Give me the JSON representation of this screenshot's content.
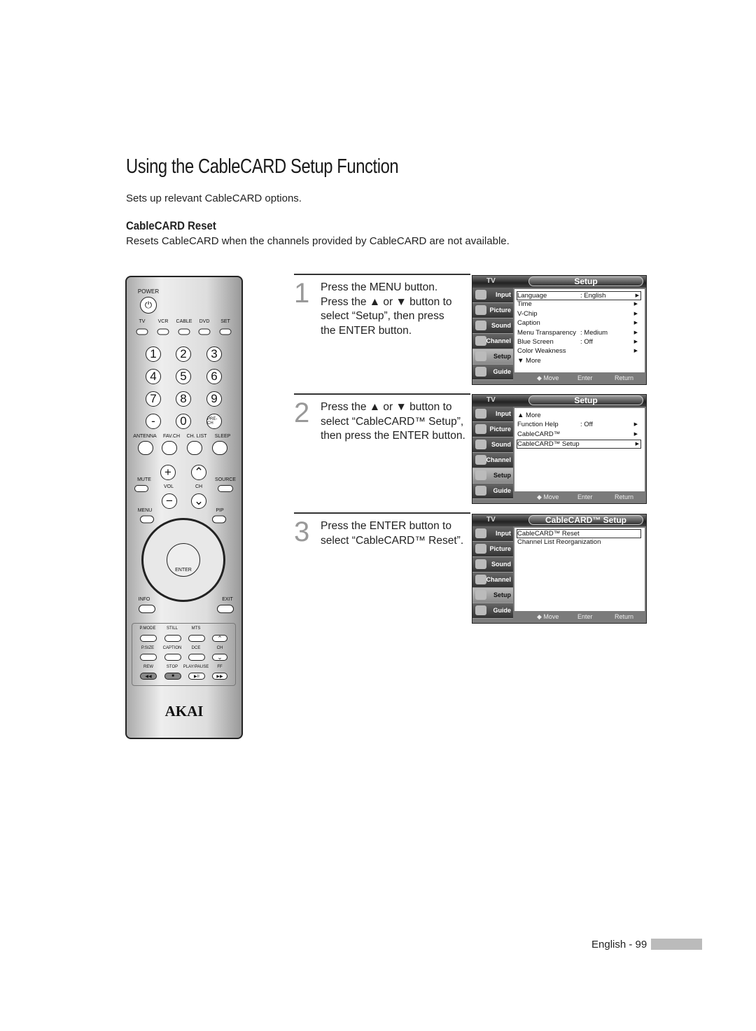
{
  "title": "Using the CableCARD Setup Function",
  "intro": "Sets up relevant CableCARD options.",
  "section": {
    "heading": "CableCARD Reset",
    "description": "Resets CableCARD when the channels provided by CableCARD are not available."
  },
  "steps": [
    {
      "number": "1",
      "text": "Press the MENU button.\nPress the ▲ or ▼ button to\nselect “Setup”, then press\nthe ENTER button."
    },
    {
      "number": "2",
      "text": "Press the ▲ or ▼ button to\nselect “CableCARD™ Setup”,\nthen press the ENTER button."
    },
    {
      "number": "3",
      "text": "Press the ENTER button to\nselect “CableCARD™ Reset”."
    }
  ],
  "osd_common": {
    "tv": "TV",
    "sidebar": [
      "Input",
      "Picture",
      "Sound",
      "Channel",
      "Setup",
      "Guide"
    ],
    "selected": "Setup",
    "move": "◆ Move",
    "enter": "Enter",
    "return": "Return"
  },
  "screens": [
    {
      "title": "Setup",
      "rows": [
        {
          "label": "Language",
          "value": ": English",
          "arrow": "▶",
          "highlight": true
        },
        {
          "label": "Time",
          "value": "",
          "arrow": "▶"
        },
        {
          "label": "V-Chip",
          "value": "",
          "arrow": "▶"
        },
        {
          "label": "Caption",
          "value": "",
          "arrow": "▶"
        },
        {
          "label": "Menu Transparency",
          "value": ": Medium",
          "arrow": "▶"
        },
        {
          "label": "Blue Screen",
          "value": ": Off",
          "arrow": "▶"
        },
        {
          "label": "Color Weakness",
          "value": "",
          "arrow": "▶"
        },
        {
          "label": "▼ More",
          "value": "",
          "arrow": ""
        }
      ]
    },
    {
      "title": "Setup",
      "rows": [
        {
          "label": "▲ More",
          "value": "",
          "arrow": ""
        },
        {
          "label": "Function Help",
          "value": ": Off",
          "arrow": "▶"
        },
        {
          "label": "CableCARD™",
          "value": "",
          "arrow": "▶"
        },
        {
          "label": "CableCARD™ Setup",
          "value": "",
          "arrow": "▶",
          "highlight": true
        }
      ]
    },
    {
      "title": "CableCARD™ Setup",
      "rows": [
        {
          "label": "CableCARD™ Reset",
          "value": "",
          "arrow": "",
          "highlight": true
        },
        {
          "label": "Channel List Reorganization",
          "value": "",
          "arrow": ""
        }
      ]
    }
  ],
  "remote": {
    "brand": "AKAI",
    "power": "POWER",
    "power_glyph": "⏻",
    "modes": [
      "TV",
      "VCR",
      "CABLE",
      "DVD",
      "SET"
    ],
    "digits": [
      "1",
      "2",
      "3",
      "4",
      "5",
      "6",
      "7",
      "8",
      "9",
      "-",
      "0",
      "PRE-CH"
    ],
    "row_labels": [
      "ANTENNA",
      "FAV.CH",
      "CH. LIST",
      "SLEEP"
    ],
    "mute": "MUTE",
    "vol": "VOL",
    "ch": "CH",
    "source": "SOURCE",
    "menu": "MENU",
    "pip": "PIP",
    "enter": "ENTER",
    "info": "INFO",
    "exit": "EXIT",
    "bottom_labels": [
      "P.MODE",
      "STILL",
      "MTS",
      "P.SIZE",
      "CAPTION",
      "DCE",
      "CH",
      "REW",
      "STOP",
      "PLAY/PAUSE",
      "FF"
    ],
    "plus": "+",
    "minus": "−",
    "up": "⌃",
    "down": "⌄",
    "rew": "◀◀",
    "stop": "■",
    "play": "▶II",
    "ff": "▶▶"
  },
  "footer": {
    "page": "English - 99"
  }
}
